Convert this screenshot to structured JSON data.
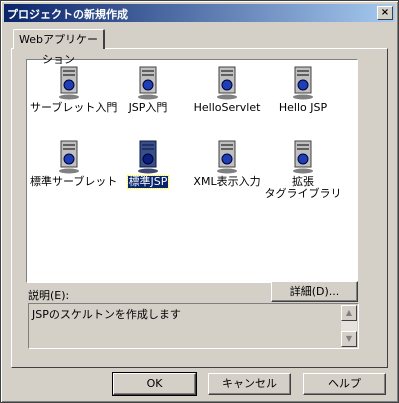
{
  "window": {
    "title": "プロジェクトの新規作成",
    "close_label": "×"
  },
  "tab": {
    "label": "Webアプリケーション"
  },
  "items": [
    {
      "label": "サーブレット入門",
      "icon": "server-icon"
    },
    {
      "label": "JSP入門",
      "icon": "server-icon"
    },
    {
      "label": "HelloServlet",
      "icon": "server-icon"
    },
    {
      "label": "Hello JSP",
      "icon": "server-icon"
    },
    {
      "label": "標準サーブレット",
      "icon": "server-icon"
    },
    {
      "label": "標準JSP",
      "icon": "server-icon",
      "selected": true
    },
    {
      "label": "XML表示入力",
      "icon": "server-icon"
    },
    {
      "label_line1": "拡張",
      "label_line2": "タグライブラリ",
      "icon": "server-icon"
    }
  ],
  "detail_button": "詳細(D)...",
  "description": {
    "label": "説明(E):",
    "text": "JSPのスケルトンを作成します"
  },
  "scroll": {
    "up": "▲",
    "down": "▼"
  },
  "buttons": {
    "ok": "OK",
    "cancel": "キャンセル",
    "help": "ヘルプ"
  },
  "colors": {
    "titlebar_start": "#0a246a",
    "titlebar_end": "#a6caf0",
    "face": "#d4d0c8",
    "selection": "#0a246a"
  }
}
